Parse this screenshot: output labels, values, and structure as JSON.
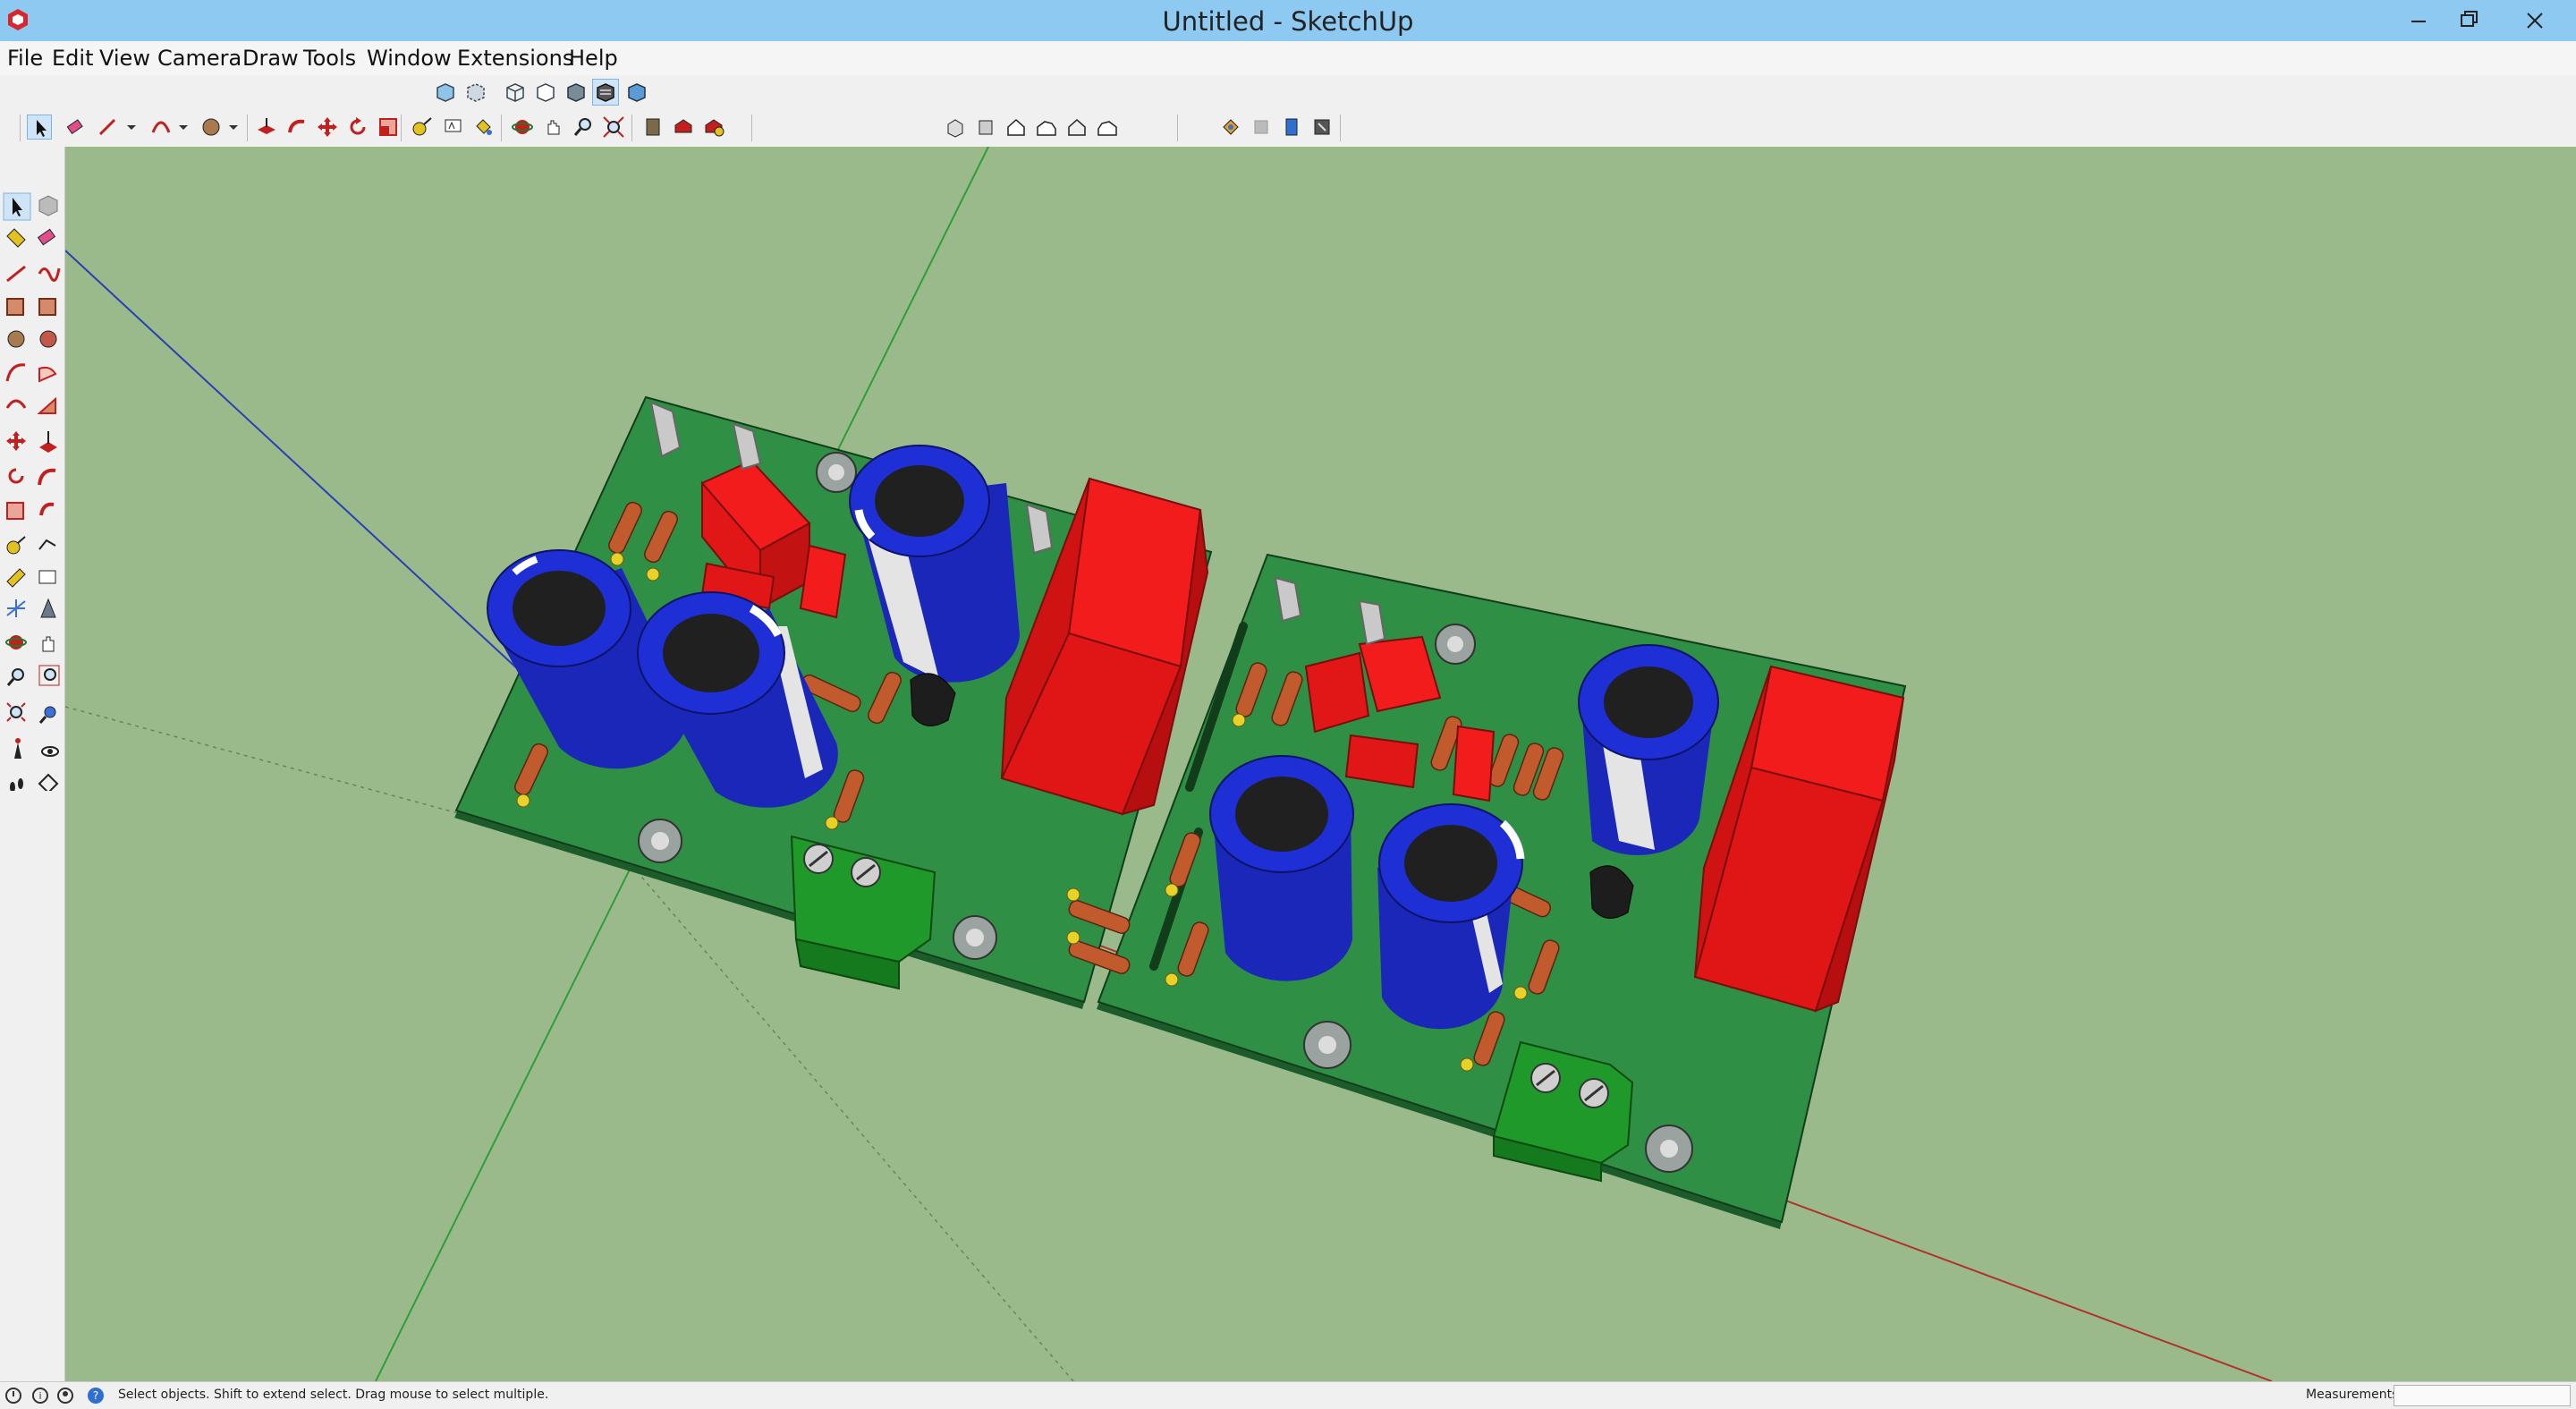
{
  "window": {
    "title": "Untitled - SketchUp",
    "buttons": [
      "minimize",
      "restore",
      "close"
    ]
  },
  "menu": {
    "items": [
      "File",
      "Edit",
      "View",
      "Camera",
      "Draw",
      "Tools",
      "Window",
      "Extensions",
      "Help"
    ]
  },
  "toolbars": {
    "style_tools": [
      "xray-icon",
      "back-edges-icon",
      "wireframe-icon",
      "hidden-line-icon",
      "shaded-icon",
      "shaded-with-textures-icon",
      "monochrome-icon"
    ],
    "getting_started_tools": [
      "select-icon",
      "eraser-icon",
      "line-icon",
      "arc-icon",
      "shapes-icon",
      "push-pull-icon",
      "follow-me-icon",
      "move-icon",
      "rotate-icon",
      "scale-icon",
      "tape-measure-icon",
      "text-icon",
      "paint-bucket-icon",
      "orbit-icon",
      "pan-icon",
      "zoom-icon",
      "zoom-extents-icon",
      "components-icon",
      "3d-warehouse-icon",
      "extension-warehouse-icon"
    ],
    "views_tools": [
      "iso-view-icon",
      "top-view-icon",
      "front-view-icon",
      "right-view-icon",
      "back-view-icon",
      "left-view-icon"
    ],
    "section_tools": [
      "section-plane-icon",
      "section-display-icon",
      "section-cut-icon",
      "section-fill-icon"
    ]
  },
  "left_toolbar": {
    "tools": [
      "select-icon",
      "make-component-icon",
      "paint-bucket-icon",
      "eraser-icon",
      "line-icon",
      "freehand-icon",
      "rectangle-icon",
      "rotated-rectangle-icon",
      "circle-icon",
      "polygon-icon",
      "arc-icon",
      "pie-icon",
      "two-point-arc-icon",
      "three-point-arc-icon",
      "move-icon",
      "push-pull-icon",
      "rotate-icon",
      "follow-me-icon",
      "scale-icon",
      "offset-icon",
      "tape-measure-icon",
      "dimension-icon",
      "protractor-icon",
      "text-icon",
      "axes-icon",
      "3d-text-icon",
      "orbit-icon",
      "pan-icon",
      "zoom-icon",
      "zoom-window-icon",
      "zoom-extents-icon",
      "previous-view-icon",
      "position-camera-icon",
      "look-around-icon",
      "walk-icon",
      "section-plane-icon"
    ]
  },
  "status": {
    "hint": "Select objects. Shift to extend select. Drag mouse to select multiple.",
    "measurements_label": "Measurements",
    "measurements_value": ""
  },
  "colors": {
    "titlebar": "#8ec9f1",
    "viewport": "#9aba8b",
    "pcb": "#2f8f45",
    "capacitor": "#1e2fd6",
    "film_capacitor": "#f21c1c",
    "resistor": "#c15a2c",
    "terminal_block": "#1f9a2a"
  }
}
